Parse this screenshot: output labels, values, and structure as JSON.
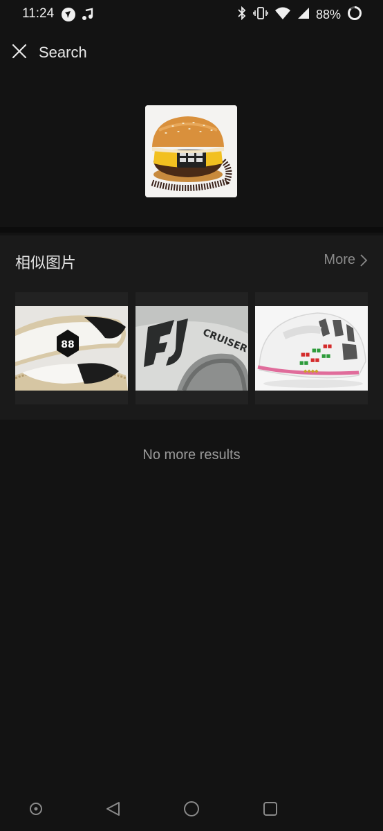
{
  "status_bar": {
    "time": "11:24",
    "battery": "88%",
    "icons": [
      "app-notification-icon",
      "music-notification-icon",
      "bluetooth-icon",
      "vibrate-icon",
      "wifi-icon",
      "cell-signal-icon",
      "battery-ring-icon"
    ]
  },
  "header": {
    "title": "Search",
    "close_icon": "close-icon"
  },
  "query_image": {
    "subject": "hamburger-phone"
  },
  "similar": {
    "title": "相似图片",
    "more_label": "More",
    "items": [
      {
        "subject": "espadrille-shoes"
      },
      {
        "subject": "fj-cruiser-logo"
      },
      {
        "subject": "white-bike-helmet"
      }
    ]
  },
  "footer_text": "No more results",
  "nav_bar": {
    "icons": [
      "accessibility-dot-icon",
      "back-icon",
      "home-icon",
      "recents-icon"
    ]
  },
  "colors": {
    "background": "#131313",
    "section_background": "#1a1a1a",
    "muted_text": "#8a8a8a"
  }
}
